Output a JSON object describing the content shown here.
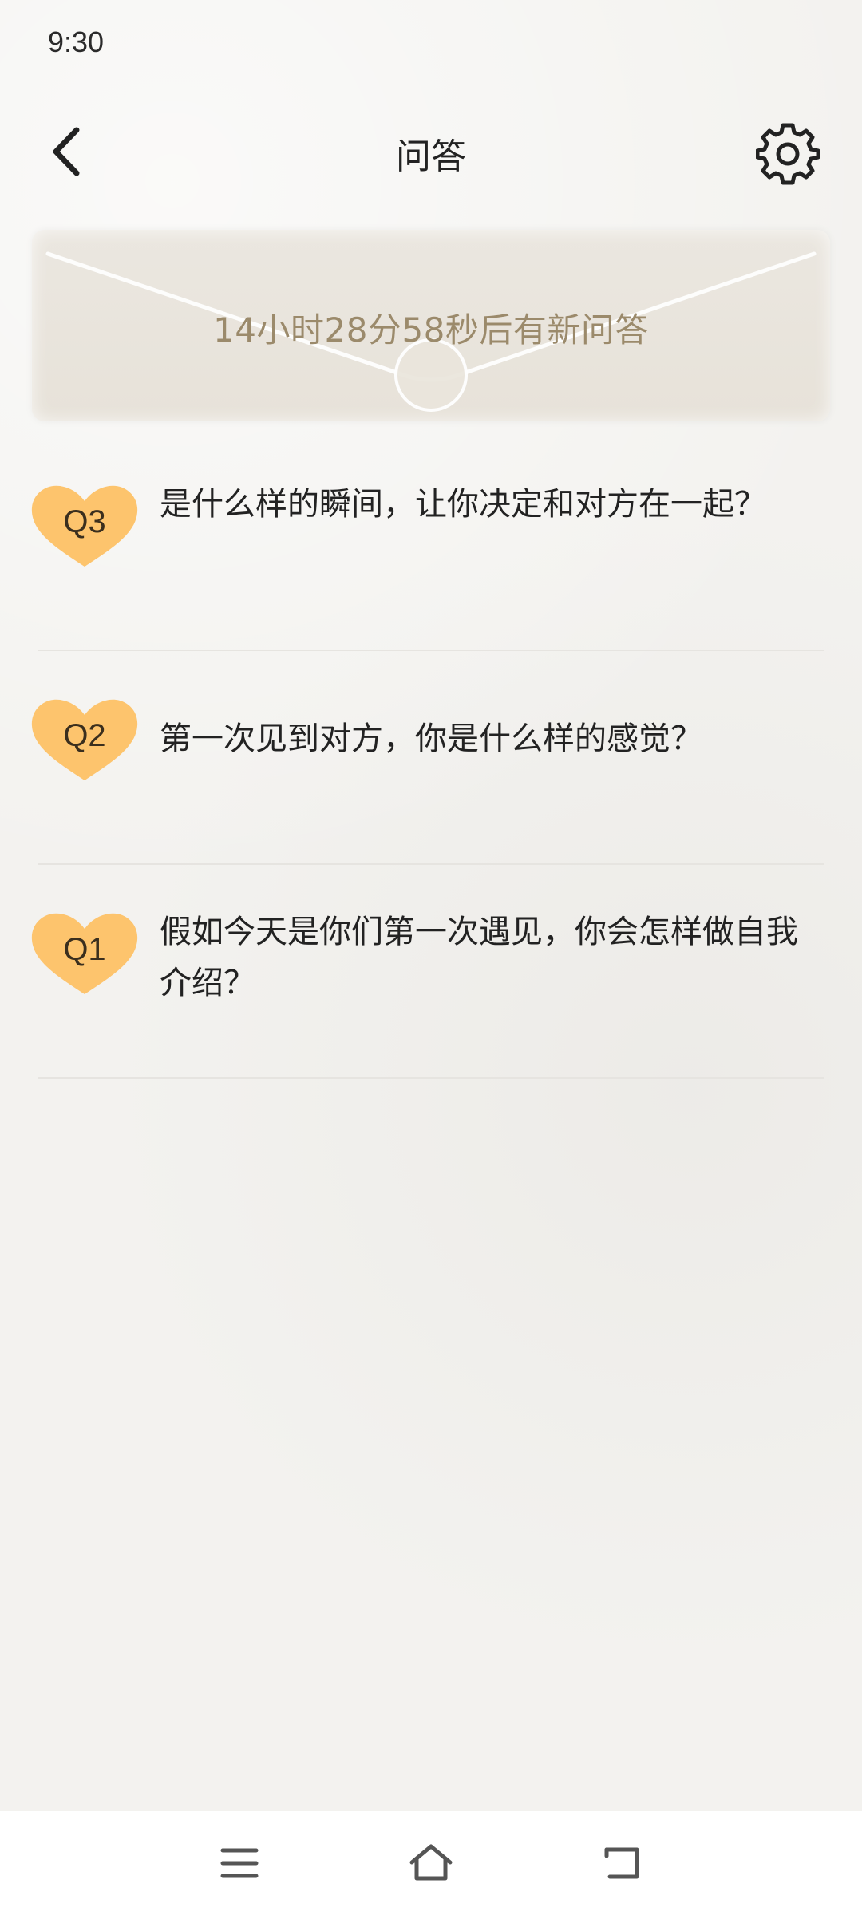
{
  "status_bar": {
    "time": "9:30"
  },
  "header": {
    "title": "问答",
    "back_icon": "chevron-left-icon",
    "settings_icon": "gear-icon"
  },
  "banner": {
    "countdown_text": "14小时28分58秒后有新问答"
  },
  "questions": [
    {
      "badge": "Q3",
      "text": "是什么样的瞬间，让你决定和对方在一起？"
    },
    {
      "badge": "Q2",
      "text": "第一次见到对方，你是什么样的感觉？"
    },
    {
      "badge": "Q1",
      "text": "假如今天是你们第一次遇见，你会怎样做自我介绍？"
    }
  ],
  "nav_bar": {
    "menu_icon": "menu-icon",
    "home_icon": "home-icon",
    "back_icon": "return-icon"
  },
  "colors": {
    "badge": "#fdc46d",
    "countdown": "#9b8a6b",
    "envelope": "#e8e3da"
  }
}
